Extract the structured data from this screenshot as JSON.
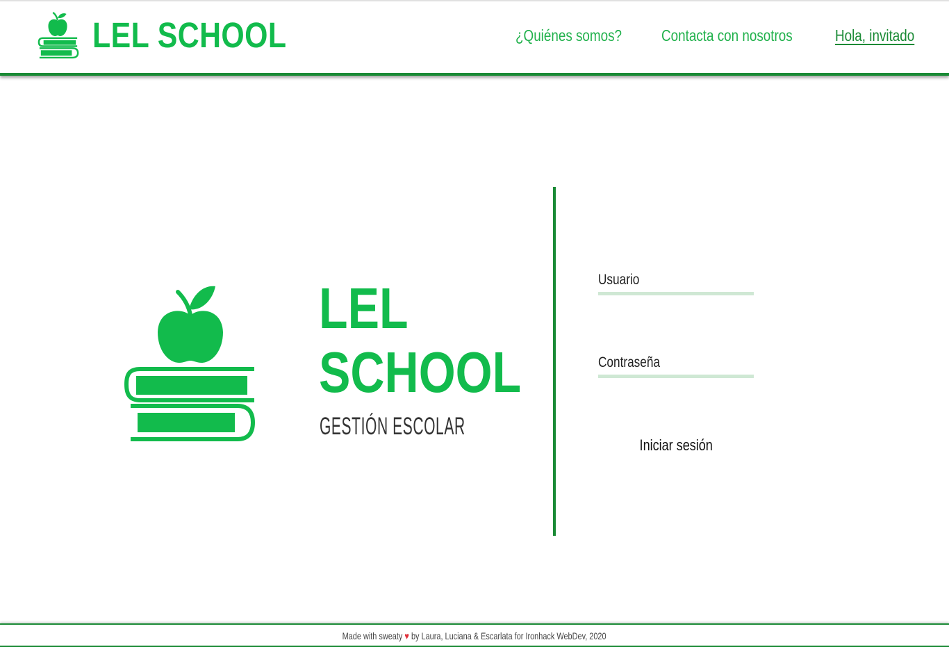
{
  "header": {
    "brand_name": "LEL SCHOOL",
    "nav": {
      "about": "¿Quiénes somos?",
      "contact": "Contacta con nosotros",
      "greeting": "Hola, invitado"
    }
  },
  "hero": {
    "title_line1": "LEL",
    "title_line2": "SCHOOL",
    "subtitle": "GESTIÓN ESCOLAR"
  },
  "login": {
    "username_label": "Usuario",
    "username_value": "",
    "password_label": "Contraseña",
    "password_value": "",
    "submit_label": "Iniciar sesión"
  },
  "footer": {
    "text_before": "Made with sweaty",
    "heart_icon": "heart-icon",
    "text_after": "by Laura, Luciana & Escarlata for Ironhack WebDev, 2020"
  },
  "colors": {
    "brand_green": "#12bb4c",
    "dark_green": "#1a8a35",
    "input_underline": "#cfe8d4",
    "heart_red": "#e0303a"
  }
}
